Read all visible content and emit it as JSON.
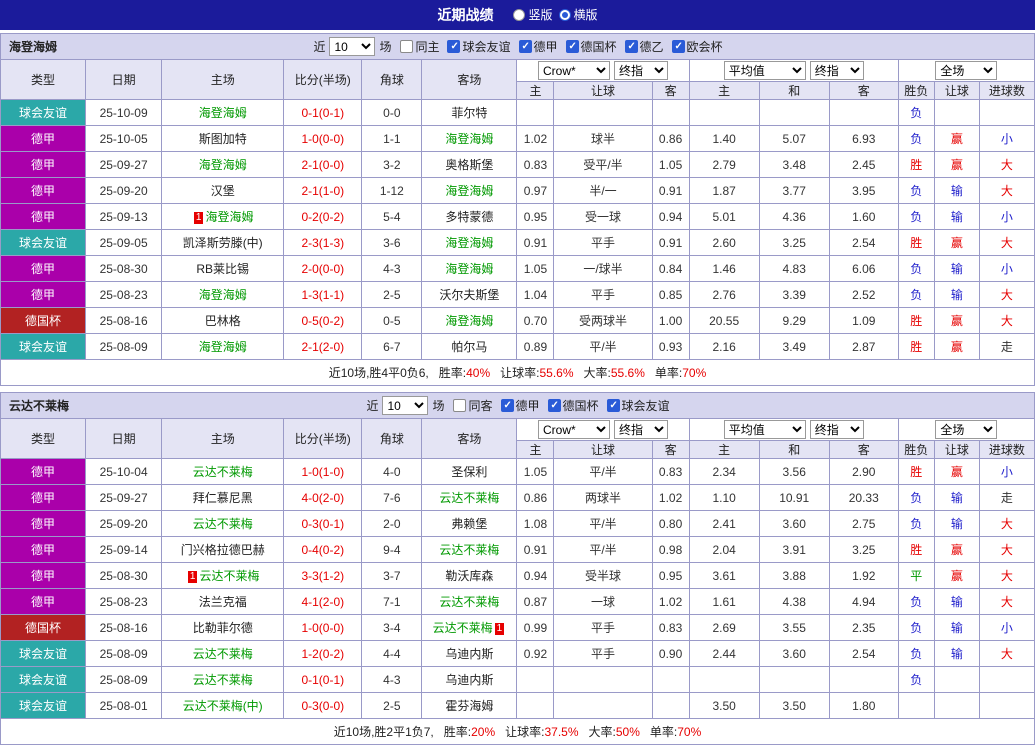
{
  "topbar": {
    "title": "近期战绩",
    "options": [
      {
        "label": "竖版",
        "selected": false
      },
      {
        "label": "横版",
        "selected": true
      }
    ]
  },
  "table": {
    "main_columns": [
      "类型",
      "日期",
      "主场",
      "比分(半场)",
      "角球",
      "客场"
    ],
    "sub_columns": [
      "主",
      "让球",
      "客",
      "主",
      "和",
      "客",
      "胜负",
      "让球",
      "进球数"
    ]
  },
  "colors": {
    "league": {
      "球会友谊": "#2ba8a8",
      "德甲": "#aa00aa",
      "德国杯": "#b22222"
    },
    "values": {
      "胜": "#e60000",
      "平": "#009900",
      "负": "#2222cc",
      "赢": "#e60000",
      "输": "#2222cc",
      "走": "#333333",
      "大": "#e60000",
      "小": "#2222cc"
    },
    "focus_team": "#009900",
    "score": "#e60000",
    "stat_value": "#e60000"
  },
  "sections": [
    {
      "team": "海登海姆",
      "filters": {
        "recent": "近",
        "count": "10",
        "games": "场",
        "same": {
          "label": "同主",
          "checked": false
        },
        "leagues": [
          {
            "label": "球会友谊",
            "checked": true
          },
          {
            "label": "德甲",
            "checked": true
          },
          {
            "label": "德国杯",
            "checked": true
          },
          {
            "label": "德乙",
            "checked": true
          },
          {
            "label": "欧会杯",
            "checked": true
          }
        ]
      },
      "selects": {
        "asian": [
          "Crow*",
          "终指"
        ],
        "euro": [
          "平均值",
          "终指"
        ],
        "scope": [
          "全场"
        ]
      },
      "rows": [
        {
          "league": "球会友谊",
          "date": "25-10-09",
          "home": {
            "name": "海登海姆",
            "focus": true
          },
          "score": "0-1(0-1)",
          "corners": "0-0",
          "away": {
            "name": "菲尔特",
            "focus": false
          },
          "ah": [
            "",
            "",
            ""
          ],
          "eu": [
            "",
            "",
            ""
          ],
          "res": [
            "负",
            "",
            ""
          ]
        },
        {
          "league": "德甲",
          "date": "25-10-05",
          "home": {
            "name": "斯图加特",
            "focus": false
          },
          "score": "1-0(0-0)",
          "corners": "1-1",
          "away": {
            "name": "海登海姆",
            "focus": true
          },
          "ah": [
            "1.02",
            "球半",
            "0.86"
          ],
          "eu": [
            "1.40",
            "5.07",
            "6.93"
          ],
          "res": [
            "负",
            "赢",
            "小"
          ]
        },
        {
          "league": "德甲",
          "date": "25-09-27",
          "home": {
            "name": "海登海姆",
            "focus": true
          },
          "score": "2-1(0-0)",
          "corners": "3-2",
          "away": {
            "name": "奥格斯堡",
            "focus": false
          },
          "ah": [
            "0.83",
            "受平/半",
            "1.05"
          ],
          "eu": [
            "2.79",
            "3.48",
            "2.45"
          ],
          "res": [
            "胜",
            "赢",
            "大"
          ]
        },
        {
          "league": "德甲",
          "date": "25-09-20",
          "home": {
            "name": "汉堡",
            "focus": false
          },
          "score": "2-1(1-0)",
          "corners": "1-12",
          "away": {
            "name": "海登海姆",
            "focus": true
          },
          "ah": [
            "0.97",
            "半/一",
            "0.91"
          ],
          "eu": [
            "1.87",
            "3.77",
            "3.95"
          ],
          "res": [
            "负",
            "输",
            "大"
          ]
        },
        {
          "league": "德甲",
          "date": "25-09-13",
          "home": {
            "name": "海登海姆",
            "focus": true,
            "badge": "1"
          },
          "score": "0-2(0-2)",
          "corners": "5-4",
          "away": {
            "name": "多特蒙德",
            "focus": false
          },
          "ah": [
            "0.95",
            "受一球",
            "0.94"
          ],
          "eu": [
            "5.01",
            "4.36",
            "1.60"
          ],
          "res": [
            "负",
            "输",
            "小"
          ]
        },
        {
          "league": "球会友谊",
          "date": "25-09-05",
          "home": {
            "name": "凯泽斯劳滕(中)",
            "focus": false
          },
          "score": "2-3(1-3)",
          "corners": "3-6",
          "away": {
            "name": "海登海姆",
            "focus": true
          },
          "ah": [
            "0.91",
            "平手",
            "0.91"
          ],
          "eu": [
            "2.60",
            "3.25",
            "2.54"
          ],
          "res": [
            "胜",
            "赢",
            "大"
          ]
        },
        {
          "league": "德甲",
          "date": "25-08-30",
          "home": {
            "name": "RB莱比锡",
            "focus": false
          },
          "score": "2-0(0-0)",
          "corners": "4-3",
          "away": {
            "name": "海登海姆",
            "focus": true
          },
          "ah": [
            "1.05",
            "一/球半",
            "0.84"
          ],
          "eu": [
            "1.46",
            "4.83",
            "6.06"
          ],
          "res": [
            "负",
            "输",
            "小"
          ]
        },
        {
          "league": "德甲",
          "date": "25-08-23",
          "home": {
            "name": "海登海姆",
            "focus": true
          },
          "score": "1-3(1-1)",
          "corners": "2-5",
          "away": {
            "name": "沃尔夫斯堡",
            "focus": false
          },
          "ah": [
            "1.04",
            "平手",
            "0.85"
          ],
          "eu": [
            "2.76",
            "3.39",
            "2.52"
          ],
          "res": [
            "负",
            "输",
            "大"
          ]
        },
        {
          "league": "德国杯",
          "date": "25-08-16",
          "home": {
            "name": "巴林格",
            "focus": false
          },
          "score": "0-5(0-2)",
          "corners": "0-5",
          "away": {
            "name": "海登海姆",
            "focus": true
          },
          "ah": [
            "0.70",
            "受两球半",
            "1.00"
          ],
          "eu": [
            "20.55",
            "9.29",
            "1.09"
          ],
          "res": [
            "胜",
            "赢",
            "大"
          ]
        },
        {
          "league": "球会友谊",
          "date": "25-08-09",
          "home": {
            "name": "海登海姆",
            "focus": true
          },
          "score": "2-1(2-0)",
          "corners": "6-7",
          "away": {
            "name": "帕尔马",
            "focus": false
          },
          "ah": [
            "0.89",
            "平/半",
            "0.93"
          ],
          "eu": [
            "2.16",
            "3.49",
            "2.87"
          ],
          "res": [
            "胜",
            "赢",
            "走"
          ]
        }
      ],
      "summary": {
        "prefix": "近10场,胜4平0负6,",
        "stats": [
          [
            "胜率:",
            "40%"
          ],
          [
            "让球率:",
            "55.6%"
          ],
          [
            "大率:",
            "55.6%"
          ],
          [
            "单率:",
            "70%"
          ]
        ]
      }
    },
    {
      "team": "云达不莱梅",
      "filters": {
        "recent": "近",
        "count": "10",
        "games": "场",
        "same": {
          "label": "同客",
          "checked": false
        },
        "leagues": [
          {
            "label": "德甲",
            "checked": true
          },
          {
            "label": "德国杯",
            "checked": true
          },
          {
            "label": "球会友谊",
            "checked": true
          }
        ]
      },
      "selects": {
        "asian": [
          "Crow*",
          "终指"
        ],
        "euro": [
          "平均值",
          "终指"
        ],
        "scope": [
          "全场"
        ]
      },
      "rows": [
        {
          "league": "德甲",
          "date": "25-10-04",
          "home": {
            "name": "云达不莱梅",
            "focus": true
          },
          "score": "1-0(1-0)",
          "corners": "4-0",
          "away": {
            "name": "圣保利",
            "focus": false
          },
          "ah": [
            "1.05",
            "平/半",
            "0.83"
          ],
          "eu": [
            "2.34",
            "3.56",
            "2.90"
          ],
          "res": [
            "胜",
            "赢",
            "小"
          ]
        },
        {
          "league": "德甲",
          "date": "25-09-27",
          "home": {
            "name": "拜仁慕尼黑",
            "focus": false
          },
          "score": "4-0(2-0)",
          "corners": "7-6",
          "away": {
            "name": "云达不莱梅",
            "focus": true
          },
          "ah": [
            "0.86",
            "两球半",
            "1.02"
          ],
          "eu": [
            "1.10",
            "10.91",
            "20.33"
          ],
          "res": [
            "负",
            "输",
            "走"
          ]
        },
        {
          "league": "德甲",
          "date": "25-09-20",
          "home": {
            "name": "云达不莱梅",
            "focus": true
          },
          "score": "0-3(0-1)",
          "corners": "2-0",
          "away": {
            "name": "弗赖堡",
            "focus": false
          },
          "ah": [
            "1.08",
            "平/半",
            "0.80"
          ],
          "eu": [
            "2.41",
            "3.60",
            "2.75"
          ],
          "res": [
            "负",
            "输",
            "大"
          ]
        },
        {
          "league": "德甲",
          "date": "25-09-14",
          "home": {
            "name": "门兴格拉德巴赫",
            "focus": false
          },
          "score": "0-4(0-2)",
          "corners": "9-4",
          "away": {
            "name": "云达不莱梅",
            "focus": true
          },
          "ah": [
            "0.91",
            "平/半",
            "0.98"
          ],
          "eu": [
            "2.04",
            "3.91",
            "3.25"
          ],
          "res": [
            "胜",
            "赢",
            "大"
          ]
        },
        {
          "league": "德甲",
          "date": "25-08-30",
          "home": {
            "name": "云达不莱梅",
            "focus": true,
            "badge": "1"
          },
          "score": "3-3(1-2)",
          "corners": "3-7",
          "away": {
            "name": "勒沃库森",
            "focus": false
          },
          "ah": [
            "0.94",
            "受半球",
            "0.95"
          ],
          "eu": [
            "3.61",
            "3.88",
            "1.92"
          ],
          "res": [
            "平",
            "赢",
            "大"
          ]
        },
        {
          "league": "德甲",
          "date": "25-08-23",
          "home": {
            "name": "法兰克福",
            "focus": false
          },
          "score": "4-1(2-0)",
          "corners": "7-1",
          "away": {
            "name": "云达不莱梅",
            "focus": true
          },
          "ah": [
            "0.87",
            "一球",
            "1.02"
          ],
          "eu": [
            "1.61",
            "4.38",
            "4.94"
          ],
          "res": [
            "负",
            "输",
            "大"
          ]
        },
        {
          "league": "德国杯",
          "date": "25-08-16",
          "home": {
            "name": "比勒菲尔德",
            "focus": false
          },
          "score": "1-0(0-0)",
          "corners": "3-4",
          "away": {
            "name": "云达不莱梅",
            "focus": true,
            "badge": "1"
          },
          "ah": [
            "0.99",
            "平手",
            "0.83"
          ],
          "eu": [
            "2.69",
            "3.55",
            "2.35"
          ],
          "res": [
            "负",
            "输",
            "小"
          ]
        },
        {
          "league": "球会友谊",
          "date": "25-08-09",
          "home": {
            "name": "云达不莱梅",
            "focus": true
          },
          "score": "1-2(0-2)",
          "corners": "4-4",
          "away": {
            "name": "乌迪内斯",
            "focus": false
          },
          "ah": [
            "0.92",
            "平手",
            "0.90"
          ],
          "eu": [
            "2.44",
            "3.60",
            "2.54"
          ],
          "res": [
            "负",
            "输",
            "大"
          ]
        },
        {
          "league": "球会友谊",
          "date": "25-08-09",
          "home": {
            "name": "云达不莱梅",
            "focus": true
          },
          "score": "0-1(0-1)",
          "corners": "4-3",
          "away": {
            "name": "乌迪内斯",
            "focus": false
          },
          "ah": [
            "",
            "",
            ""
          ],
          "eu": [
            "",
            "",
            ""
          ],
          "res": [
            "负",
            "",
            ""
          ]
        },
        {
          "league": "球会友谊",
          "date": "25-08-01",
          "home": {
            "name": "云达不莱梅(中)",
            "focus": true
          },
          "score": "0-3(0-0)",
          "corners": "2-5",
          "away": {
            "name": "霍芬海姆",
            "focus": false
          },
          "ah": [
            "",
            "",
            ""
          ],
          "eu": [
            "3.50",
            "3.50",
            "1.80"
          ],
          "res": [
            "",
            "",
            ""
          ]
        }
      ],
      "summary": {
        "prefix": "近10场,胜2平1负7,",
        "stats": [
          [
            "胜率:",
            "20%"
          ],
          [
            "让球率:",
            "37.5%"
          ],
          [
            "大率:",
            "50%"
          ],
          [
            "单率:",
            "70%"
          ]
        ]
      }
    }
  ]
}
